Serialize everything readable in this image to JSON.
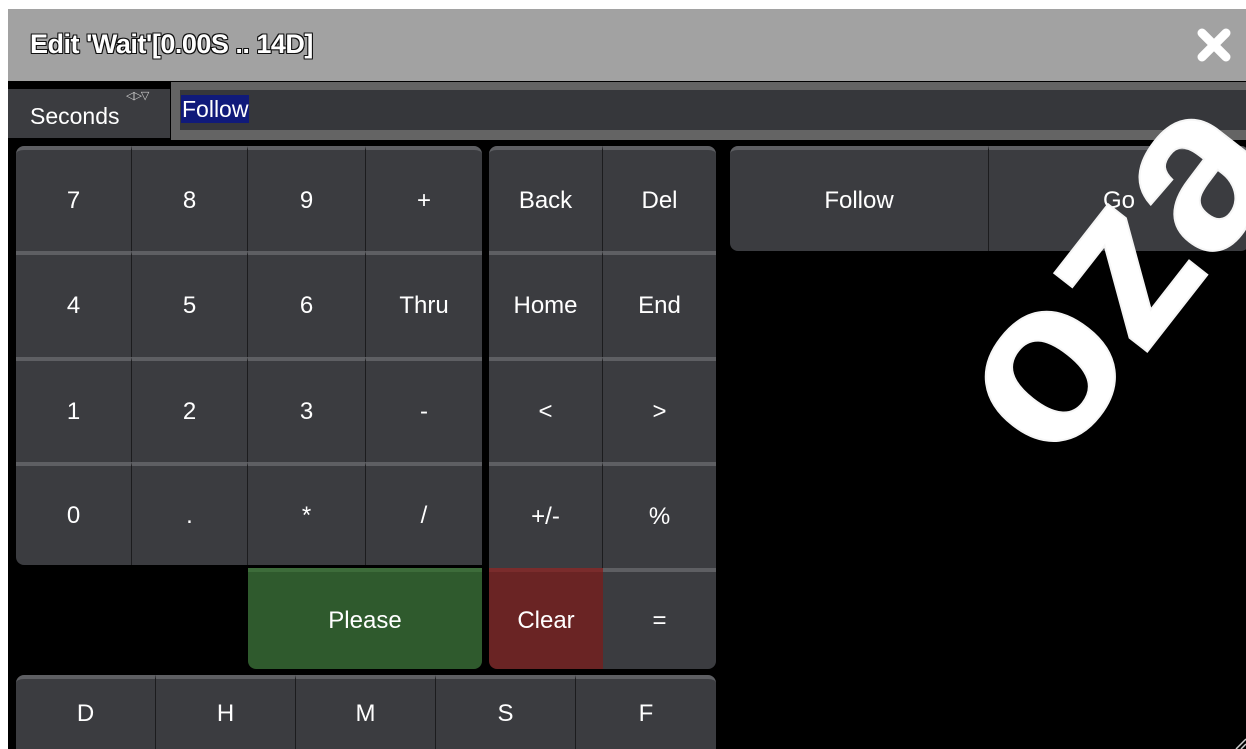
{
  "title": "Edit 'Wait'[0.00S .. 14D]",
  "unit_selector": {
    "label": "Seconds",
    "arrows": "◁▷▽"
  },
  "input": {
    "value": "Follow"
  },
  "keypad": {
    "r1": [
      "7",
      "8",
      "9",
      "+"
    ],
    "r2": [
      "4",
      "5",
      "6",
      "Thru"
    ],
    "r3": [
      "1",
      "2",
      "3",
      "-"
    ],
    "r4": [
      "0",
      ".",
      "*",
      "/"
    ],
    "please": "Please"
  },
  "edit_keys": {
    "back": "Back",
    "del": "Del",
    "home": "Home",
    "end": "End",
    "left": "<",
    "right": ">",
    "plusminus": "+/-",
    "percent": "%",
    "clear": "Clear",
    "equals": "="
  },
  "units_row": [
    "D",
    "H",
    "M",
    "S",
    "F"
  ],
  "quick": {
    "follow": "Follow",
    "go": "Go"
  },
  "watermark": "oza.com",
  "colors": {
    "titlebar": "#a2a2a2",
    "key": "#3b3c40",
    "please_green": "#2f5a2d",
    "clear_red": "#6a2424",
    "selection": "#101a7a"
  },
  "icons": {
    "close": "close-x-icon",
    "unit_arrows": "dropdown-arrows-icon"
  }
}
